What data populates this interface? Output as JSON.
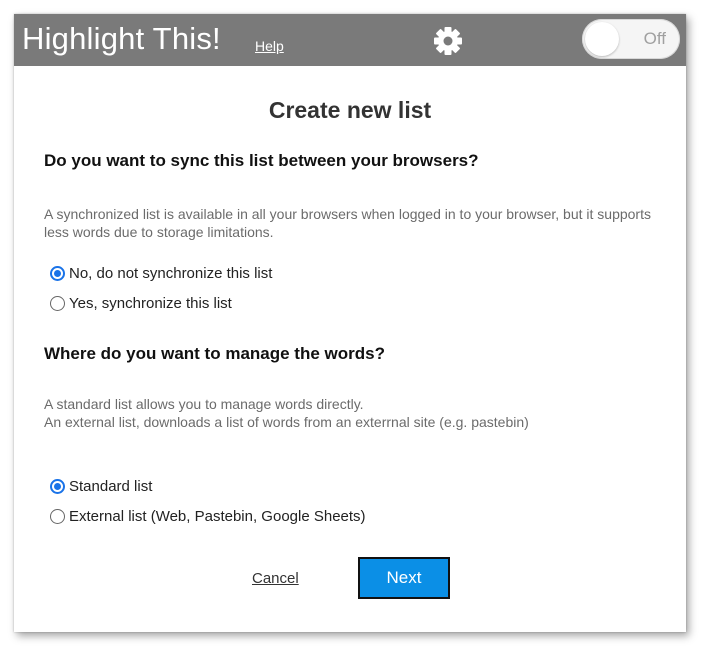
{
  "header": {
    "app_title": "Highlight This!",
    "help_label": "Help",
    "settings_icon": "gear-icon",
    "toggle_label": "Off",
    "toggle_state": "off",
    "bar_color": "#7a7a7a"
  },
  "dialog": {
    "title": "Create new list",
    "sync": {
      "question": "Do you want to sync this list between your browsers?",
      "description": "A synchronized list is available in all your browsers when logged in to your browser, but it supports less words due to storage limitations.",
      "options": [
        {
          "label": "No, do not synchronize this list",
          "checked": true
        },
        {
          "label": "Yes, synchronize this list",
          "checked": false
        }
      ]
    },
    "manage": {
      "question": "Where do you want to manage the words?",
      "description_line1": "A standard list allows you to manage words directly.",
      "description_line2": "An external list, downloads a list of words from an exterrnal site (e.g. pastebin)",
      "options": [
        {
          "label": "Standard list",
          "checked": true
        },
        {
          "label": "External list (Web, Pastebin, Google Sheets)",
          "checked": false
        }
      ]
    },
    "cancel_label": "Cancel",
    "next_label": "Next",
    "accent_color": "#0b8fe6"
  }
}
